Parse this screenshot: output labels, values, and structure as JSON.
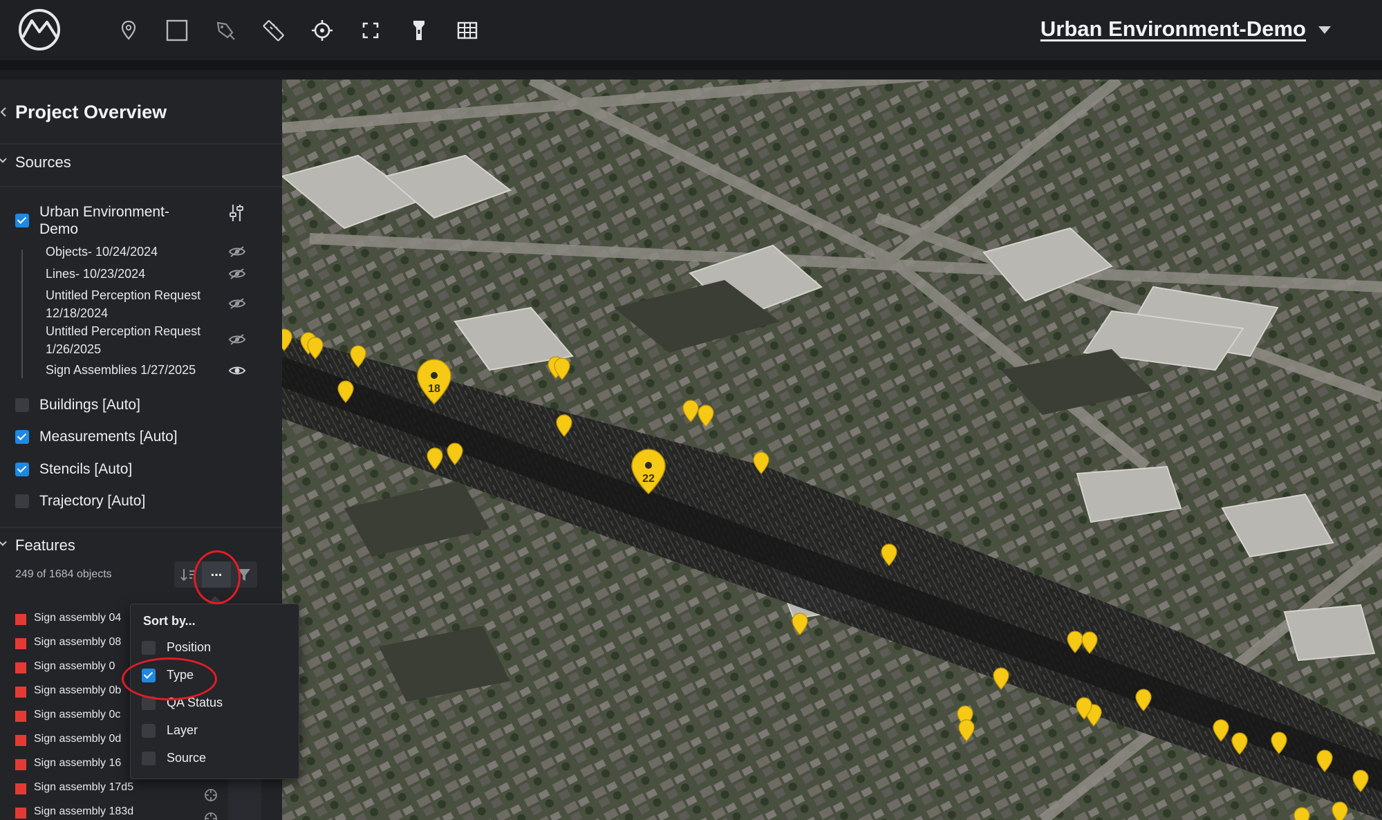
{
  "header": {
    "project_name": "Urban Environment-Demo",
    "tools": [
      "marker-tool",
      "rectangle-tool",
      "pen-tool",
      "ruler-tool",
      "crosshair-tool",
      "fit-view-tool",
      "flashlight-tool",
      "grid-tool"
    ]
  },
  "sidebar": {
    "title": "Project Overview",
    "sources_label": "Sources",
    "source": {
      "name_line1": "Urban Environment-",
      "name_line2": "Demo",
      "layers": [
        {
          "line1": "Objects- 10/24/2024",
          "line2": "",
          "visible": false
        },
        {
          "line1": "Lines- 10/23/2024",
          "line2": "",
          "visible": false
        },
        {
          "line1": "Untitled Perception Request",
          "line2": "12/18/2024",
          "visible": false
        },
        {
          "line1": "Untitled Perception Request",
          "line2": "1/26/2025",
          "visible": false
        },
        {
          "line1": "Sign Assemblies 1/27/2025",
          "line2": "",
          "visible": true
        }
      ]
    },
    "auto_layers": [
      {
        "label": "Buildings [Auto]",
        "checked": false
      },
      {
        "label": "Measurements [Auto]",
        "checked": true
      },
      {
        "label": "Stencils [Auto]",
        "checked": true
      },
      {
        "label": "Trajectory [Auto]",
        "checked": false
      }
    ],
    "features_label": "Features",
    "count_text": "249 of 1684 objects",
    "more_button_label": "...",
    "features": [
      {
        "label": "Sign assembly 04"
      },
      {
        "label": "Sign assembly 08"
      },
      {
        "label": "Sign assembly 0"
      },
      {
        "label": "Sign assembly 0b"
      },
      {
        "label": "Sign assembly 0c"
      },
      {
        "label": "Sign assembly 0d"
      },
      {
        "label": "Sign assembly 16"
      },
      {
        "label": "Sign assembly 17d5"
      },
      {
        "label": "Sign assembly 183d"
      }
    ]
  },
  "sort_menu": {
    "title": "Sort by...",
    "options": [
      {
        "label": "Position",
        "checked": false
      },
      {
        "label": "Type",
        "checked": true
      },
      {
        "label": "QA Status",
        "checked": false
      },
      {
        "label": "Layer",
        "checked": false
      },
      {
        "label": "Source",
        "checked": false
      }
    ]
  },
  "map": {
    "clusters": [
      {
        "count": "18"
      },
      {
        "count": "22"
      }
    ],
    "pin_color": "#f6c915"
  },
  "colors": {
    "accent": "#1e88e5",
    "feature_marker": "#e53935",
    "annotation": "#e31c25"
  }
}
